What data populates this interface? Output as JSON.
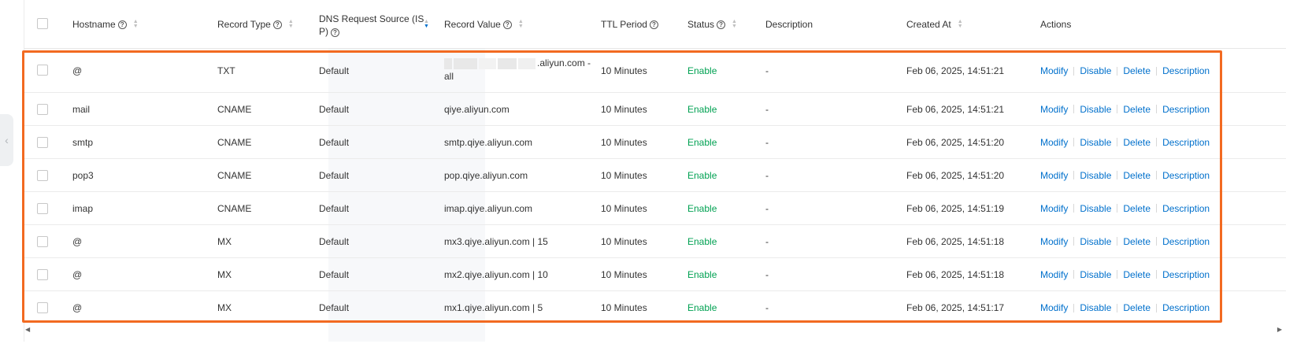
{
  "columns": {
    "hostname": "Hostname",
    "record_type": "Record Type",
    "dns_source_line1": "DNS Request Source (IS",
    "dns_source_line2": "P)",
    "record_value": "Record Value",
    "ttl": "TTL Period",
    "status": "Status",
    "description": "Description",
    "created_at": "Created At",
    "actions": "Actions"
  },
  "actions": {
    "modify": "Modify",
    "disable": "Disable",
    "delete": "Delete",
    "description": "Description"
  },
  "rows": [
    {
      "hostname": "@",
      "type": "TXT",
      "source": "Default",
      "value_line1": ".aliyun.com -",
      "value_line2": "all",
      "ttl": "10 Minutes",
      "status": "Enable",
      "description": "-",
      "created": "Feb 06, 2025, 14:51:21"
    },
    {
      "hostname": "mail",
      "type": "CNAME",
      "source": "Default",
      "value": "qiye.aliyun.com",
      "ttl": "10 Minutes",
      "status": "Enable",
      "description": "-",
      "created": "Feb 06, 2025, 14:51:21"
    },
    {
      "hostname": "smtp",
      "type": "CNAME",
      "source": "Default",
      "value": "smtp.qiye.aliyun.com",
      "ttl": "10 Minutes",
      "status": "Enable",
      "description": "-",
      "created": "Feb 06, 2025, 14:51:20"
    },
    {
      "hostname": "pop3",
      "type": "CNAME",
      "source": "Default",
      "value": "pop.qiye.aliyun.com",
      "ttl": "10 Minutes",
      "status": "Enable",
      "description": "-",
      "created": "Feb 06, 2025, 14:51:20"
    },
    {
      "hostname": "imap",
      "type": "CNAME",
      "source": "Default",
      "value": "imap.qiye.aliyun.com",
      "ttl": "10 Minutes",
      "status": "Enable",
      "description": "-",
      "created": "Feb 06, 2025, 14:51:19"
    },
    {
      "hostname": "@",
      "type": "MX",
      "source": "Default",
      "value": "mx3.qiye.aliyun.com | 15",
      "ttl": "10 Minutes",
      "status": "Enable",
      "description": "-",
      "created": "Feb 06, 2025, 14:51:18"
    },
    {
      "hostname": "@",
      "type": "MX",
      "source": "Default",
      "value": "mx2.qiye.aliyun.com | 10",
      "ttl": "10 Minutes",
      "status": "Enable",
      "description": "-",
      "created": "Feb 06, 2025, 14:51:18"
    },
    {
      "hostname": "@",
      "type": "MX",
      "source": "Default",
      "value": "mx1.qiye.aliyun.com | 5",
      "ttl": "10 Minutes",
      "status": "Enable",
      "description": "-",
      "created": "Feb 06, 2025, 14:51:17"
    }
  ],
  "colors": {
    "link": "#0070cc",
    "enable": "#00a152",
    "highlight": "#f26a21"
  },
  "icons": {
    "sidebar_toggle": "chevron-left-icon",
    "help": "question-circle-icon",
    "sort": "sort-icon"
  }
}
